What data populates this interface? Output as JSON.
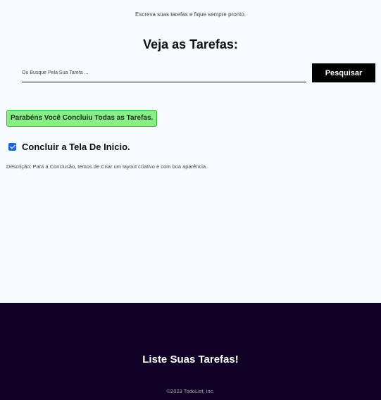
{
  "header": {
    "tagline": "Escreva suas tarefas e fique sempre pronto.",
    "title": "Veja as Tarefas:"
  },
  "search": {
    "placeholder": "Ou Busque Pela Sua Tarefa ...",
    "value": "",
    "button_label": "Pesquisar"
  },
  "status": {
    "banner_text": "Parabéns Você Concluiu Todas as Tarefas.",
    "banner_color": "#86f086"
  },
  "tasks": [
    {
      "title": "Concluir a Tela De Inicio.",
      "checked": true,
      "description": "Descrição: Para a Conclusão, temos de Criar um layout criativo e com boa aparência."
    }
  ],
  "footer": {
    "title": "Liste Suas Tarefas!",
    "copyright": "©2023 TodoList, inc.",
    "background_color": "#100025"
  }
}
